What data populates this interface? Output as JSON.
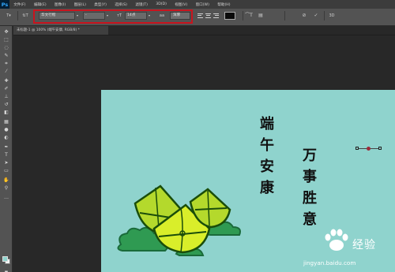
{
  "app": {
    "logo": "Ps"
  },
  "menu": [
    "文件(F)",
    "编辑(E)",
    "图像(I)",
    "图层(L)",
    "类型(Y)",
    "选择(S)",
    "滤镜(T)",
    "3D(D)",
    "视图(V)",
    "窗口(W)",
    "帮助(H)"
  ],
  "options": {
    "font_family": "华文行楷",
    "font_style": "-",
    "font_size": "14点",
    "anti_alias_icon": "aa",
    "anti_alias": "浑厚",
    "text_color": "#0a0a0a",
    "cancel_icon": "cancel-icon",
    "commit_icon": "check-icon",
    "threed": "3D"
  },
  "document": {
    "tab_title": "未标题-1 @ 100% (端午安康, RGB/8) *"
  },
  "canvas": {
    "background": "#8fd3cd",
    "text_left": [
      "端",
      "午",
      "安",
      "康"
    ],
    "text_right": [
      "万",
      "事",
      "胜",
      "意"
    ]
  },
  "watermark": {
    "brand": "经验",
    "url": "jingyan.baidu.com"
  },
  "colors": {
    "foreground": "#8ed3cd",
    "background": "#ffffff",
    "highlight": "#c8141e"
  }
}
